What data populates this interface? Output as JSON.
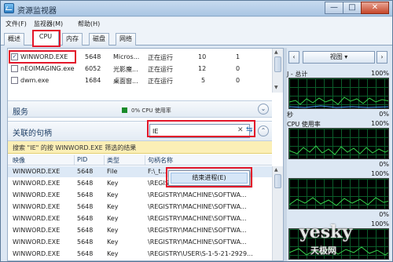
{
  "window": {
    "title": "资源监视器",
    "buttons": [
      "—",
      "□",
      "✕"
    ]
  },
  "menu": [
    "文件(F)",
    "监视器(M)",
    "帮助(H)"
  ],
  "tabs": [
    "概述",
    "CPU",
    "内存",
    "磁盘",
    "网络"
  ],
  "processes": [
    {
      "name": "WINWORD.EXE",
      "pid": "5648",
      "desc": "Micros...",
      "status": "正在运行",
      "threads": "10",
      "cpu": "1",
      "checked": true
    },
    {
      "name": "nEOIMAGING.exe",
      "pid": "6052",
      "desc": "光影魔...",
      "status": "正在运行",
      "threads": "12",
      "cpu": "0",
      "checked": false
    },
    {
      "name": "dwm.exe",
      "pid": "1684",
      "desc": "桌面窗...",
      "status": "正在运行",
      "threads": "5",
      "cpu": "0",
      "checked": false
    }
  ],
  "services": {
    "title": "服务",
    "cpu_text": "0% CPU 使用率"
  },
  "handles": {
    "title": "关联的句柄",
    "search_value": "IE",
    "banner": "搜索 \"IE\" 的按 WINWORD.EXE 筛选的结果",
    "columns": [
      "映像",
      "PID",
      "类型",
      "句柄名称"
    ],
    "rows": [
      {
        "image": "WINWORD.EXE",
        "pid": "5648",
        "type": "File",
        "name": "F:\\_t..."
      },
      {
        "image": "WINWORD.EXE",
        "pid": "5648",
        "type": "Key",
        "name": "\\REGISTRY\\..."
      },
      {
        "image": "WINWORD.EXE",
        "pid": "5648",
        "type": "Key",
        "name": "\\REGISTRY\\MACHINE\\SOFTWA..."
      },
      {
        "image": "WINWORD.EXE",
        "pid": "5648",
        "type": "Key",
        "name": "\\REGISTRY\\MACHINE\\SOFTWA..."
      },
      {
        "image": "WINWORD.EXE",
        "pid": "5648",
        "type": "Key",
        "name": "\\REGISTRY\\MACHINE\\SOFTWA..."
      },
      {
        "image": "WINWORD.EXE",
        "pid": "5648",
        "type": "Key",
        "name": "\\REGISTRY\\MACHINE\\SOFTWA..."
      },
      {
        "image": "WINWORD.EXE",
        "pid": "5648",
        "type": "Key",
        "name": "\\REGISTRY\\MACHINE\\SOFTWA..."
      },
      {
        "image": "WINWORD.EXE",
        "pid": "5648",
        "type": "Key",
        "name": "\\REGISTRY\\USER\\S-1-5-21-2929..."
      }
    ]
  },
  "context_menu": {
    "item": "结束进程(E)"
  },
  "right_panel": {
    "view_label": "视图",
    "graphs": [
      {
        "label": "J - 总计",
        "pct_top": "100%",
        "pct_bottom": "0%",
        "bottom_label": "秒"
      },
      {
        "label": "CPU 使用率",
        "pct_top": "100%",
        "pct_bottom": "0%"
      },
      {
        "label": "",
        "pct_top": "100%",
        "pct_bottom": "0%"
      },
      {
        "label": "",
        "pct_top": "100%",
        "pct_bottom": ""
      }
    ]
  },
  "watermark": {
    "main": "yesky",
    "sub": "天极网"
  }
}
